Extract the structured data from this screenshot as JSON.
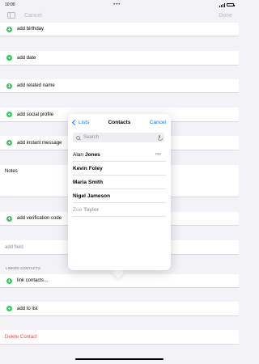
{
  "status": {
    "time": "10:00",
    "dots": "•••"
  },
  "nav": {
    "cancel": "Cancel",
    "done": "Done"
  },
  "rows": {
    "add_birthday": "add birthday",
    "add_date": "add date",
    "add_related_name": "add related name",
    "add_social_profile": "add social profile",
    "add_instant_message": "add instant message",
    "notes": "Notes",
    "add_verification_code": "add verification code",
    "add_field": "add field",
    "linked_contacts_header": "LINKED CONTACTS",
    "link_contacts": "link contacts...",
    "add_to_list": "add to list",
    "delete_contact": "Delete Contact"
  },
  "popover": {
    "back": "Lists",
    "title": "Contacts",
    "cancel": "Cancel",
    "search_placeholder": "Search",
    "contacts": [
      {
        "first": "Alan",
        "last": "Jones",
        "tag": "me"
      },
      {
        "first": "Kevin",
        "last": "Foley"
      },
      {
        "first": "Maria",
        "last": "Smith"
      },
      {
        "first": "Nigel",
        "last": "Jameson"
      },
      {
        "first": "Zoe",
        "last": "Taylor"
      }
    ]
  },
  "colors": {
    "accent": "#007aff",
    "add": "#35c759",
    "destructive": "#ff3b30"
  }
}
